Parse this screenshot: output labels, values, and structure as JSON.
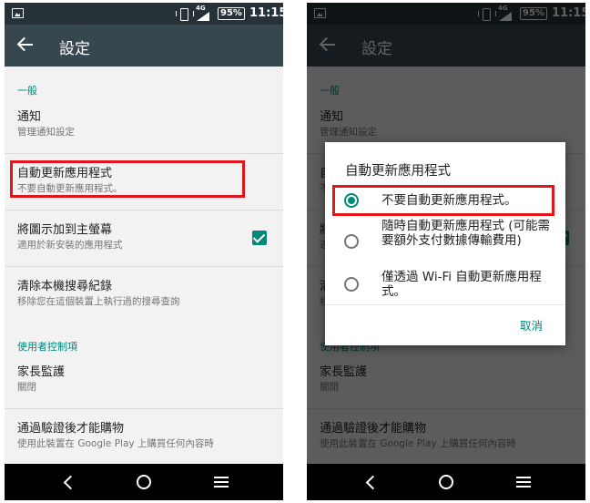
{
  "status_bar": {
    "network": "4G",
    "battery": "95%",
    "time": "11:15"
  },
  "toolbar": {
    "title": "設定"
  },
  "sections": {
    "general": "一般",
    "user_controls": "使用者控制項"
  },
  "settings": [
    {
      "title": "通知",
      "subtitle": "管理通知設定"
    },
    {
      "title": "自動更新應用程式",
      "subtitle": "不要自動更新應用程式。"
    },
    {
      "title": "將圖示加到主螢幕",
      "subtitle": "適用於新安裝的應用程式",
      "checked": true
    },
    {
      "title": "清除本機搜尋紀錄",
      "subtitle": "移除您在這個裝置上執行過的搜尋查詢"
    },
    {
      "title": "家長監護",
      "subtitle": "關閉"
    },
    {
      "title": "通過驗證後才能購物",
      "subtitle": "使用此裝置在 Google Play 上購買任何內容時"
    }
  ],
  "dialog": {
    "title": "自動更新應用程式",
    "options": [
      {
        "label": "不要自動更新應用程式。",
        "selected": true
      },
      {
        "label": "隨時自動更新應用程式 (可能需要額外支付數據傳輸費用)",
        "selected": false
      },
      {
        "label": "僅透過 Wi-Fi 自動更新應用程式。",
        "selected": false
      }
    ],
    "cancel": "取消"
  },
  "colors": {
    "accent": "#00897b",
    "toolbar": "#37474f",
    "status_bar": "#263238",
    "highlight": "#e0161b"
  }
}
